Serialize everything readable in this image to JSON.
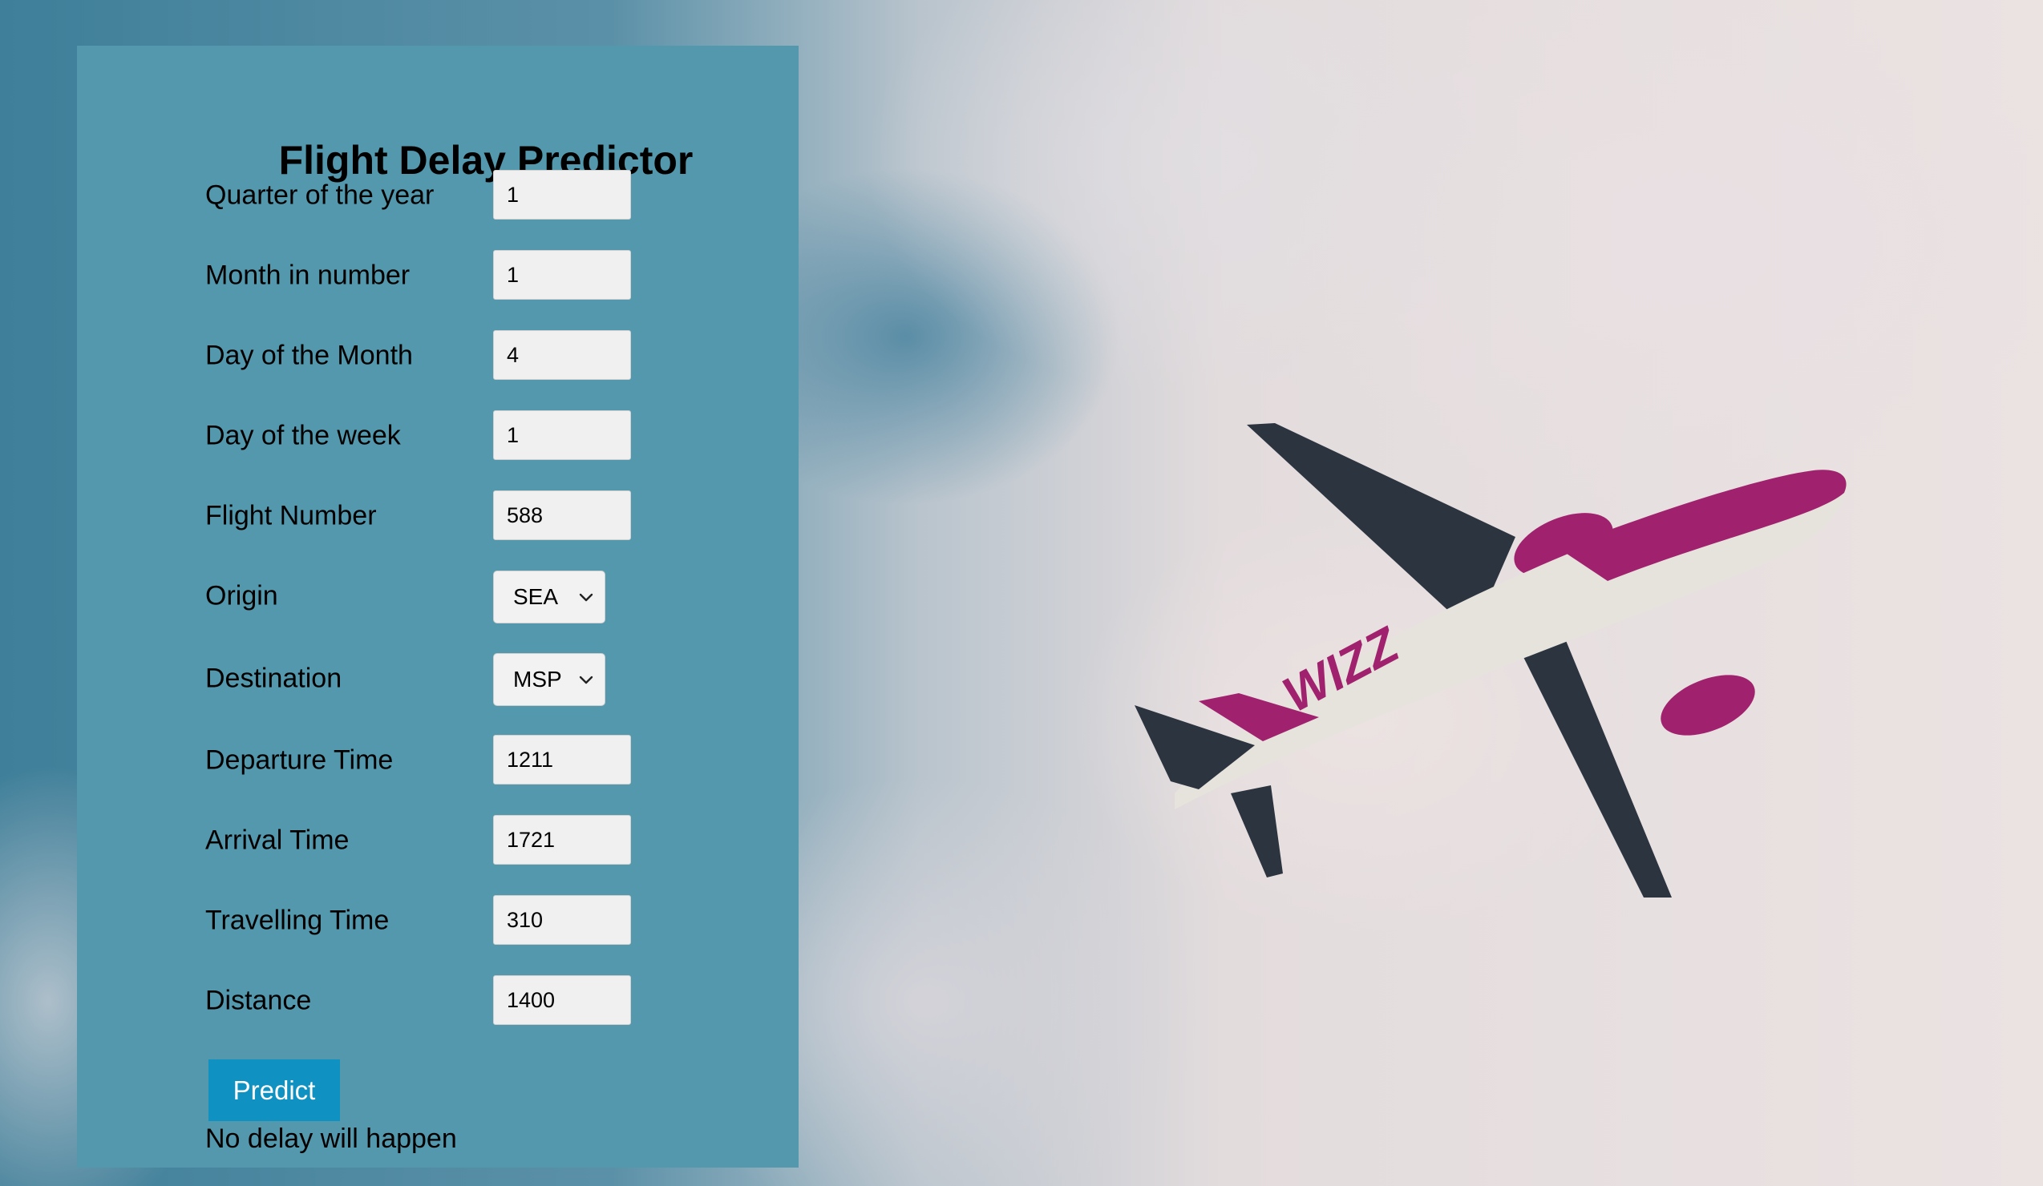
{
  "form": {
    "title": "Flight Delay Predictor",
    "fields": [
      {
        "label": "Quarter of the year",
        "value": "1"
      },
      {
        "label": "Month in number",
        "value": "1"
      },
      {
        "label": "Day of the Month",
        "value": "4"
      },
      {
        "label": "Day of the week",
        "value": "1"
      },
      {
        "label": "Flight Number",
        "value": "588"
      }
    ],
    "origin": {
      "label": "Origin",
      "selected": "SEA"
    },
    "destination": {
      "label": "Destination",
      "selected": "MSP"
    },
    "fields2": [
      {
        "label": "Departure Time",
        "value": "1211"
      },
      {
        "label": "Arrival Time",
        "value": "1721"
      },
      {
        "label": "Travelling Time",
        "value": "310"
      },
      {
        "label": "Distance",
        "value": "1400"
      }
    ],
    "predict_label": "Predict",
    "result_text": "No delay will happen"
  },
  "background": {
    "airplane_livery_text": "WIZZ"
  },
  "colors": {
    "panel": "#5398ad",
    "button": "#0f91c1",
    "airplane_accent": "#a0226e"
  }
}
